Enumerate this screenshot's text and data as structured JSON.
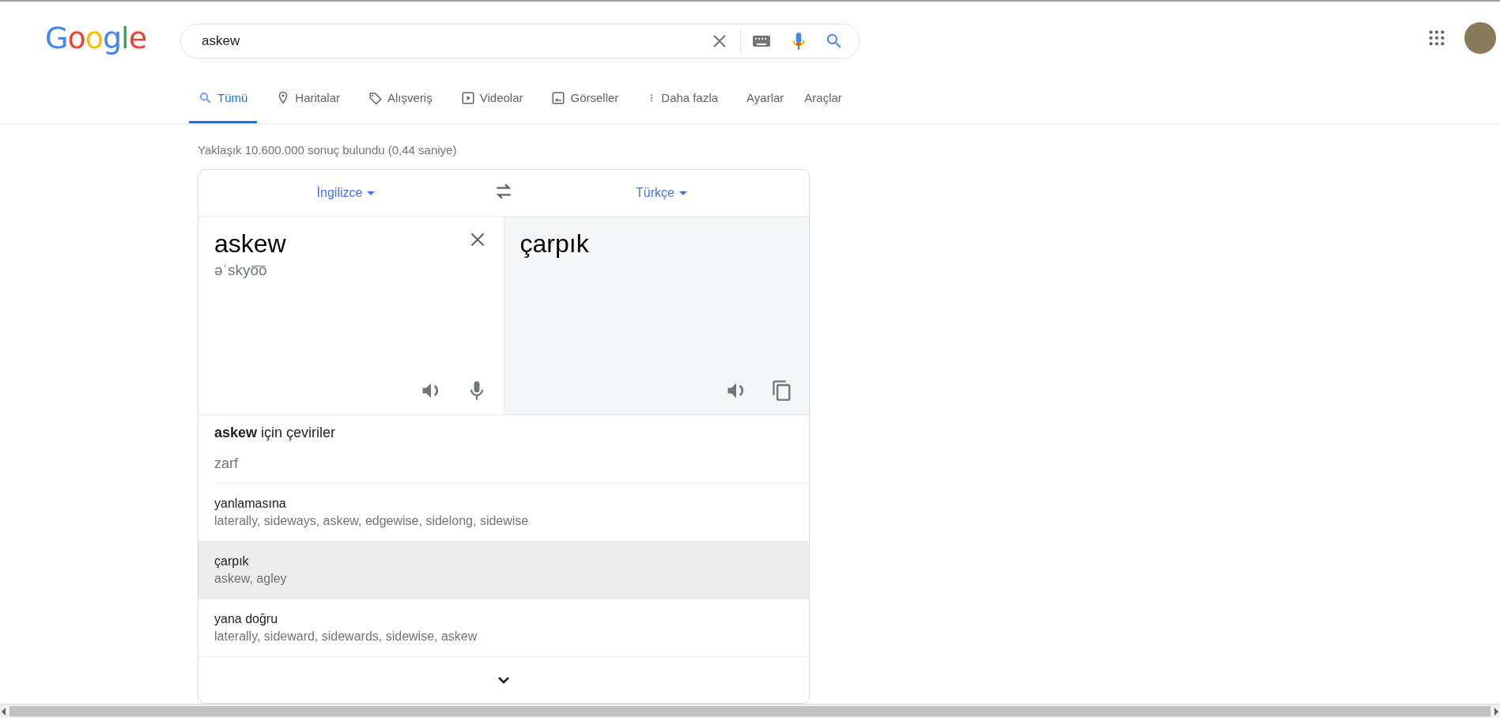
{
  "logo": "Google",
  "search": {
    "value": "askew"
  },
  "tabs": [
    {
      "label": "Tümü",
      "kind": "search",
      "selected": true
    },
    {
      "label": "Haritalar",
      "kind": "maps",
      "selected": false
    },
    {
      "label": "Alışveriş",
      "kind": "shopping",
      "selected": false
    },
    {
      "label": "Videolar",
      "kind": "videos",
      "selected": false
    },
    {
      "label": "Görseller",
      "kind": "images",
      "selected": false
    },
    {
      "label": "Daha fazla",
      "kind": "more",
      "selected": false
    },
    {
      "label": "Ayarlar",
      "kind": "plain",
      "selected": false
    },
    {
      "label": "Araçlar",
      "kind": "plain",
      "selected": false
    }
  ],
  "result_stats": "Yaklaşık 10.600.000 sonuç bulundu (0,44 saniye)",
  "translator": {
    "source_language": "İngilizce",
    "target_language": "Türkçe",
    "source_text": "askew",
    "pronunciation": "əˈskyo͞o",
    "translation": "çarpık"
  },
  "dictionary": {
    "heading": "**askew** için çeviriler",
    "part_of_speech": "zarf",
    "entries": [
      {
        "word": "yanlamasına",
        "synonyms": "laterally, sideways, askew, edgewise, sidelong, sidewise",
        "selected": false
      },
      {
        "word": "çarpık",
        "synonyms": "askew, agley",
        "selected": true
      },
      {
        "word": "yana doğru",
        "synonyms": "laterally, sideward, sidewards, sidewise, askew",
        "selected": false
      }
    ]
  }
}
